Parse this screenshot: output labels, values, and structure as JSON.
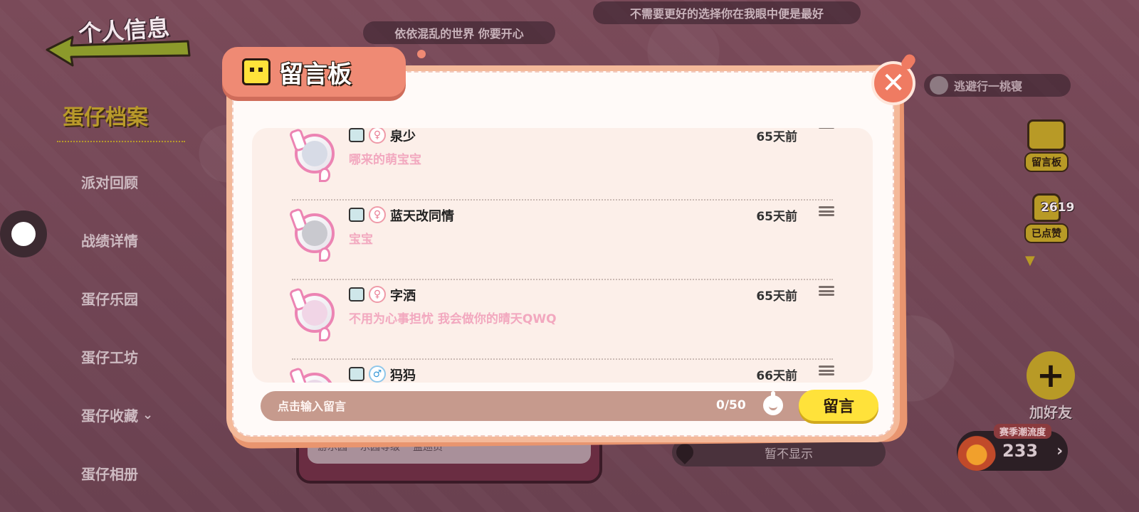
{
  "background": {
    "profile_title": "个人信息",
    "top_banner_1": "不需要更好的选择你在我眼中便是最好",
    "top_banner_2": "依依混乱的世界 你要开心",
    "top_banner_3": "逃避行一桃寝",
    "side_nav": {
      "header": "蛋仔档案",
      "items": [
        {
          "label": "派对回顾"
        },
        {
          "label": "战绩详情"
        },
        {
          "label": "蛋仔乐园"
        },
        {
          "label": "蛋仔工坊"
        },
        {
          "label": "蛋仔收藏",
          "has_chevron": true,
          "chevron": "⌄"
        },
        {
          "label": "蛋仔相册"
        }
      ]
    },
    "right_panel": {
      "board_label": "留言板",
      "like_label": "已点赞",
      "like_count": "2619",
      "add_friend_label": "加好友",
      "add_friend_icon": "+",
      "trend_label": "赛季潮流度",
      "trend_value": "233",
      "trend_arrow": "›"
    },
    "bottom_card": {
      "labels": [
        "游乐园",
        "乐园等级",
        "监巡员"
      ]
    },
    "location_text": "暂不显示"
  },
  "modal": {
    "title": "留言板",
    "close_icon": "✕",
    "messages": [
      {
        "name": "泉少",
        "gender": "female",
        "gender_symbol": "♀",
        "time": "65天前",
        "text": "哪来的萌宝宝",
        "avatar_color": "#d7dbe6"
      },
      {
        "name": "蓝天改同情",
        "gender": "female",
        "gender_symbol": "♀",
        "time": "65天前",
        "text": "宝宝",
        "avatar_color": "#c9c9cf"
      },
      {
        "name": "字洒",
        "gender": "female",
        "gender_symbol": "♀",
        "time": "65天前",
        "text": "不用为心事担忧 我会做你的晴天QWQ",
        "avatar_color": "#f1d5e6"
      },
      {
        "name": "犸犸",
        "gender": "male",
        "gender_symbol": "♂",
        "time": "66天前",
        "text": "",
        "avatar_color": "#ead9e8"
      }
    ],
    "input": {
      "placeholder": "点击输入留言",
      "char_count": "0/50",
      "submit_label": "留言"
    }
  },
  "colors": {
    "accent": "#ef8a74",
    "button_yellow": "#ffe23a",
    "message_text": "#f2a8bf",
    "avatar_ring": "#ec84b3"
  }
}
